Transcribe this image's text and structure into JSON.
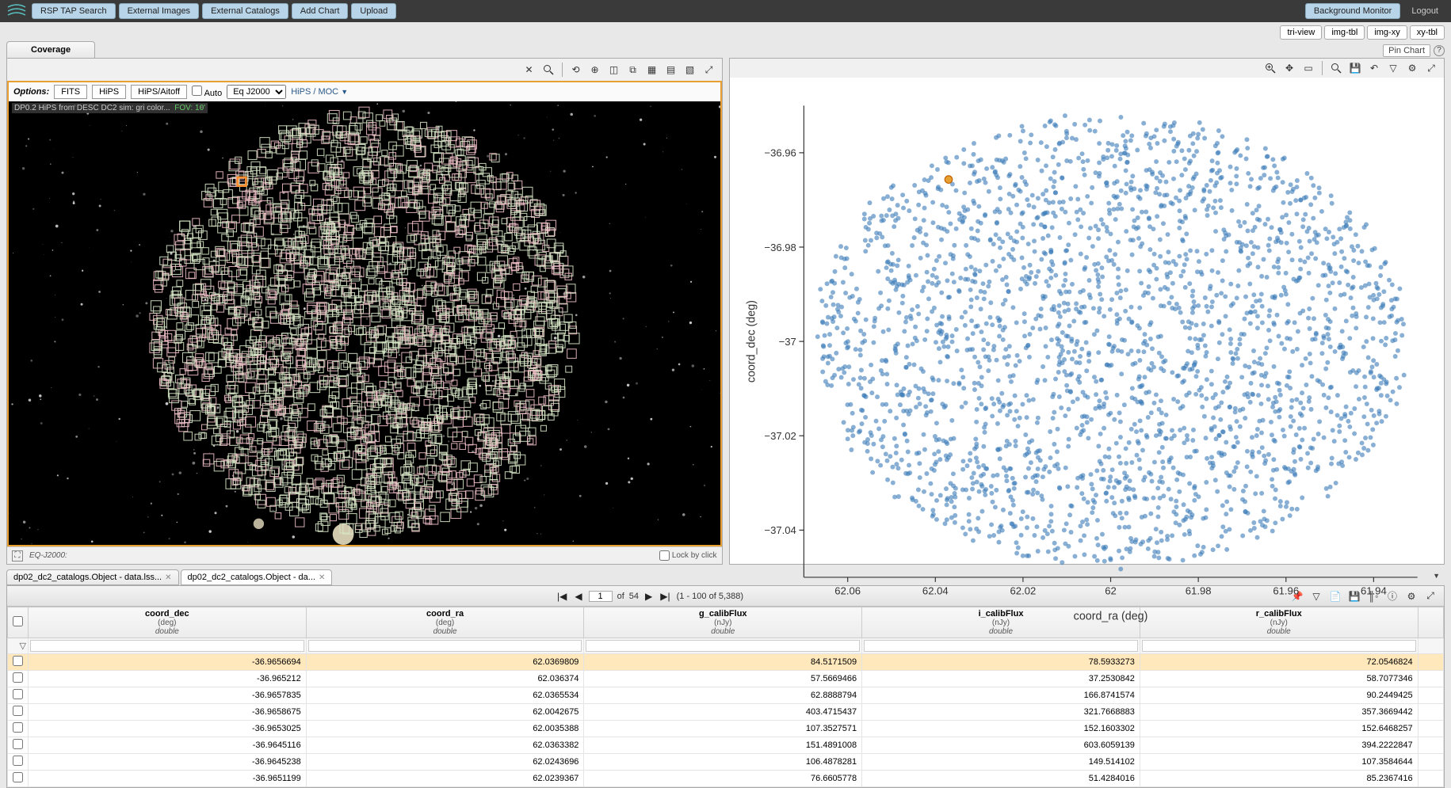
{
  "topbar": {
    "buttons": [
      "RSP TAP Search",
      "External Images",
      "External Catalogs",
      "Add Chart",
      "Upload"
    ],
    "bg_monitor": "Background Monitor",
    "logout": "Logout"
  },
  "viewbar": {
    "buttons": [
      "tri-view",
      "img-tbl",
      "img-xy",
      "xy-tbl"
    ],
    "pin": "Pin Chart"
  },
  "coverage_tab": "Coverage",
  "options": {
    "label": "Options:",
    "fits": "FITS",
    "hips": "HiPS",
    "hips_aitoff": "HiPS/Aitoff",
    "auto": "Auto",
    "frame": "Eq J2000",
    "hips_moc": "HiPS / MOC"
  },
  "image": {
    "caption": "DP0.2 HiPS from DESC DC2 sim: gri color...",
    "fov": "FOV: 10'",
    "footer_frame": "EQ-J2000:",
    "lock": "Lock by click"
  },
  "chart_data": {
    "type": "scatter",
    "xlabel": "coord_ra (deg)",
    "ylabel": "coord_dec (deg)",
    "x_ticks": [
      62.06,
      62.04,
      62.02,
      62,
      61.98,
      61.96,
      61.94
    ],
    "y_ticks": [
      -36.96,
      -36.98,
      -37,
      -37.02,
      -37.04
    ],
    "x_range": [
      62.07,
      61.93
    ],
    "y_range": [
      -37.05,
      -36.95
    ],
    "highlight": {
      "x": 62.0369809,
      "y": -36.9656694
    },
    "n_points": 2500
  },
  "bottom_tabs": [
    {
      "label": "dp02_dc2_catalogs.Object - data.lss...",
      "active": false
    },
    {
      "label": "dp02_dc2_catalogs.Object - da...",
      "active": true
    }
  ],
  "paging": {
    "current": "1",
    "total": "54",
    "range": "(1 - 100 of 5,388)",
    "of": "of"
  },
  "table": {
    "columns": [
      {
        "name": "coord_dec",
        "unit": "(deg)",
        "type": "double"
      },
      {
        "name": "coord_ra",
        "unit": "(deg)",
        "type": "double"
      },
      {
        "name": "g_calibFlux",
        "unit": "(nJy)",
        "type": "double"
      },
      {
        "name": "i_calibFlux",
        "unit": "(nJy)",
        "type": "double"
      },
      {
        "name": "r_calibFlux",
        "unit": "(nJy)",
        "type": "double"
      }
    ],
    "rows": [
      [
        "-36.9656694",
        "62.0369809",
        "84.5171509",
        "78.5933273",
        "72.0546824"
      ],
      [
        "-36.965212",
        "62.036374",
        "57.5669466",
        "37.2530842",
        "58.7077346"
      ],
      [
        "-36.9657835",
        "62.0365534",
        "62.8888794",
        "166.8741574",
        "90.2449425"
      ],
      [
        "-36.9658675",
        "62.0042675",
        "403.4715437",
        "321.7668883",
        "357.3669442"
      ],
      [
        "-36.9653025",
        "62.0035388",
        "107.3527571",
        "152.1603302",
        "152.6468257"
      ],
      [
        "-36.9645116",
        "62.0363382",
        "151.4891008",
        "603.6059139",
        "394.2222847"
      ],
      [
        "-36.9645238",
        "62.0243696",
        "106.4878281",
        "149.514102",
        "107.3584644"
      ],
      [
        "-36.9651199",
        "62.0239367",
        "76.6605778",
        "51.4284016",
        "85.2367416"
      ]
    ]
  }
}
